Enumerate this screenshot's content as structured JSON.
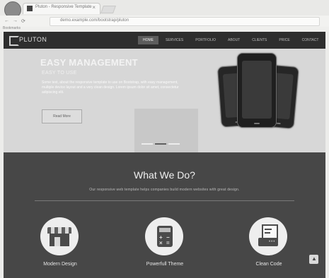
{
  "browser": {
    "tab_title": "Pluton - Responsive Template",
    "url": "demo.example.com/bootstrap/pluton",
    "bookmarks_label": "Bookmarks"
  },
  "site": {
    "logo_text": "PLUTON",
    "menu": [
      "HOME",
      "SERVICES",
      "PORTFOLIO",
      "ABOUT",
      "CLIENTS",
      "PRICE",
      "CONTACT"
    ],
    "hero": {
      "title": "EASY MANAGEMENT",
      "subtitle": "EASY TO USE",
      "text": "Some text, about the responsive template to use on Bootstrap, with easy management, multiple device layout and a very clean design. Lorem ipsum dolor sit amet, consectetur adipiscing elit.",
      "button": "Read More"
    },
    "services": {
      "title": "What We Do?",
      "subtitle": "Our responsive web template helps companies build modern websites with great design.",
      "features": [
        {
          "label": "Modern Design"
        },
        {
          "label": "Powerfull Theme"
        },
        {
          "label": "Clean Code"
        }
      ]
    }
  },
  "colors": {
    "header": "#2e2e2e",
    "services_bg": "#474747",
    "hero_bg": "#d7d7d7"
  },
  "icons": {
    "avatar": "user-avatar-icon",
    "feature_1": "shop-icon",
    "feature_2": "calculator-icon",
    "feature_3": "code-sheet-icon",
    "scroll": "arrow-up-icon"
  }
}
